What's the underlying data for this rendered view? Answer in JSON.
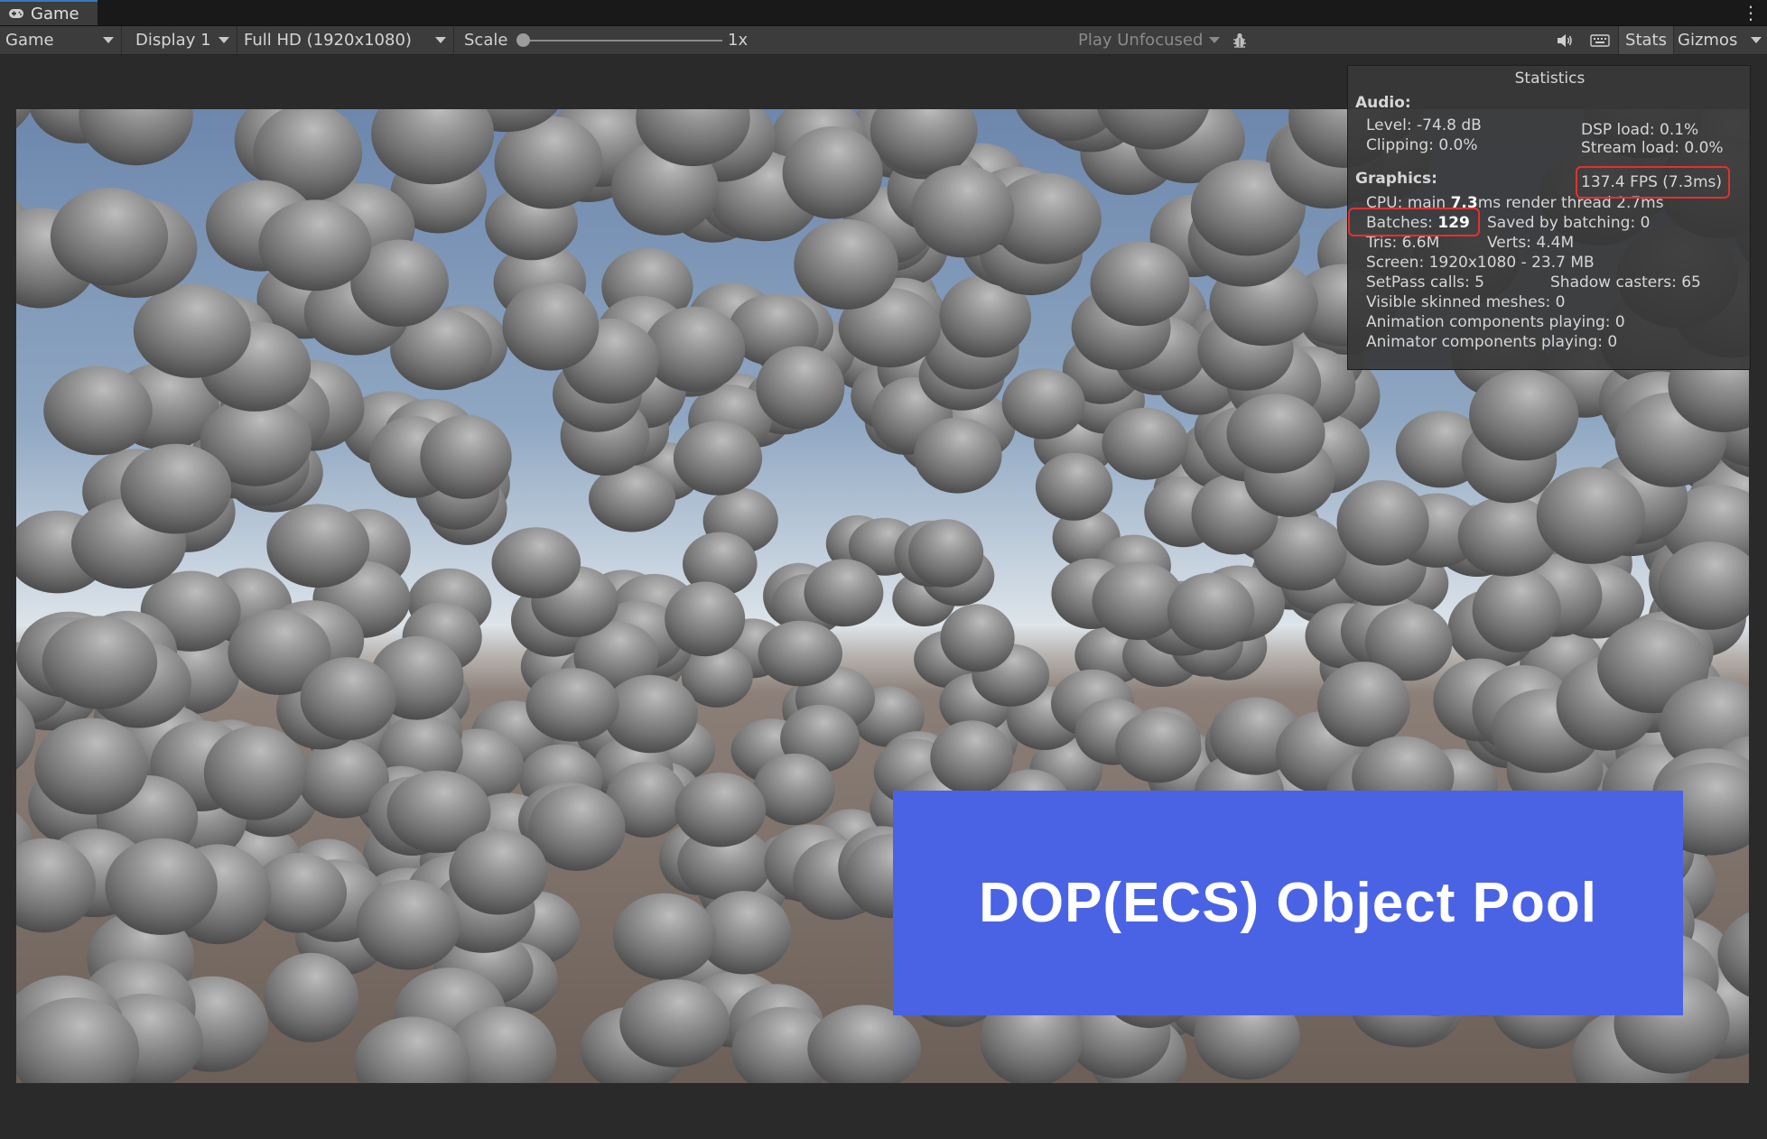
{
  "window_tab": {
    "title": "Game",
    "icon": "gamepad-icon"
  },
  "toolbar": {
    "view_mode": "Game",
    "display": "Display 1",
    "resolution": "Full HD (1920x1080)",
    "scale_label": "Scale",
    "scale_value": "1x",
    "play_mode": "Play Unfocused",
    "stats_label": "Stats",
    "gizmos_label": "Gizmos"
  },
  "statistics": {
    "title": "Statistics",
    "audio_header": "Audio:",
    "level": "Level: -74.8 dB",
    "clipping": "Clipping: 0.0%",
    "dsp_load": "DSP load: 0.1%",
    "stream_load": "Stream load: 0.0%",
    "graphics_header": "Graphics:",
    "fps": "137.4 FPS (7.3ms)",
    "cpu_prefix": "CPU: main ",
    "cpu_main": "7.3",
    "cpu_suffix": "ms  render thread 2.7ms",
    "batches_label": "Batches: ",
    "batches_value": "129",
    "saved_by_batching": "Saved by batching: 0",
    "tris": "Tris: 6.6M",
    "verts": "Verts: 4.4M",
    "screen": "Screen: 1920x1080 - 23.7 MB",
    "setpass": "SetPass calls: 5",
    "shadow_casters": "Shadow casters: 65",
    "skinned_meshes": "Visible skinned meshes: 0",
    "animation_components": "Animation components playing: 0",
    "animator_components": "Animator components playing: 0"
  },
  "banner": {
    "text": "DOP(ECS) Object Pool"
  },
  "colors": {
    "highlight": "#e2312f",
    "banner_bg": "#4a63e4"
  }
}
